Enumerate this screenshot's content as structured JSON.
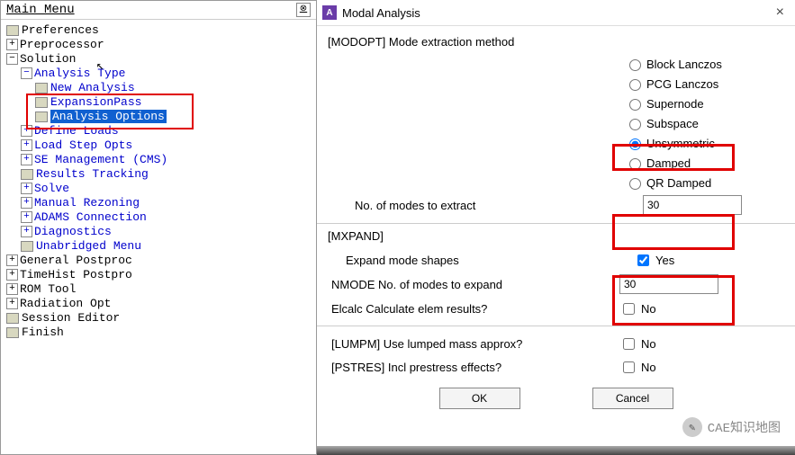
{
  "tree": {
    "title": "Main Menu",
    "items": {
      "preferences": "Preferences",
      "preprocessor": "Preprocessor",
      "solution": "Solution",
      "analysis_type": "Analysis Type",
      "new_analysis": "New Analysis",
      "expansion_pass": "ExpansionPass",
      "analysis_options": "Analysis Options",
      "define_loads": "Define Loads",
      "load_step_opts": "Load Step Opts",
      "se_management": "SE Management (CMS)",
      "results_tracking": "Results Tracking",
      "solve": "Solve",
      "manual_rezoning": "Manual Rezoning",
      "adams_connection": "ADAMS Connection",
      "diagnostics": "Diagnostics",
      "unabridged_menu": "Unabridged Menu",
      "general_postproc": "General Postproc",
      "timehist_postpro": "TimeHist Postpro",
      "rom_tool": "ROM Tool",
      "radiation_opt": "Radiation Opt",
      "session_editor": "Session Editor",
      "finish": "Finish"
    }
  },
  "dialog": {
    "title": "Modal Analysis",
    "modopt_label": "[MODOPT] Mode extraction method",
    "radios": {
      "block_lanczos": "Block Lanczos",
      "pcg_lanczos": "PCG Lanczos",
      "supernode": "Supernode",
      "subspace": "Subspace",
      "unsymmetric": "Unsymmetric",
      "damped": "Damped",
      "qr_damped": "QR Damped"
    },
    "selected_radio": "unsymmetric",
    "n_modes_extract_label": "No. of modes to extract",
    "n_modes_extract_value": "30",
    "mxpand_label": "[MXPAND]",
    "expand_label": "Expand mode shapes",
    "expand_value": "Yes",
    "expand_checked": true,
    "nmode_label": "NMODE No. of modes to expand",
    "nmode_value": "30",
    "elcalc_label": "Elcalc   Calculate elem results?",
    "elcalc_value": "No",
    "elcalc_checked": false,
    "lumpm_label": "[LUMPM]  Use lumped mass approx?",
    "lumpm_value": "No",
    "lumpm_checked": false,
    "pstres_label": "[PSTRES] Incl prestress effects?",
    "pstres_value": "No",
    "pstres_checked": false,
    "ok": "OK",
    "cancel": "Cancel"
  },
  "watermark": "CAE知识地图"
}
